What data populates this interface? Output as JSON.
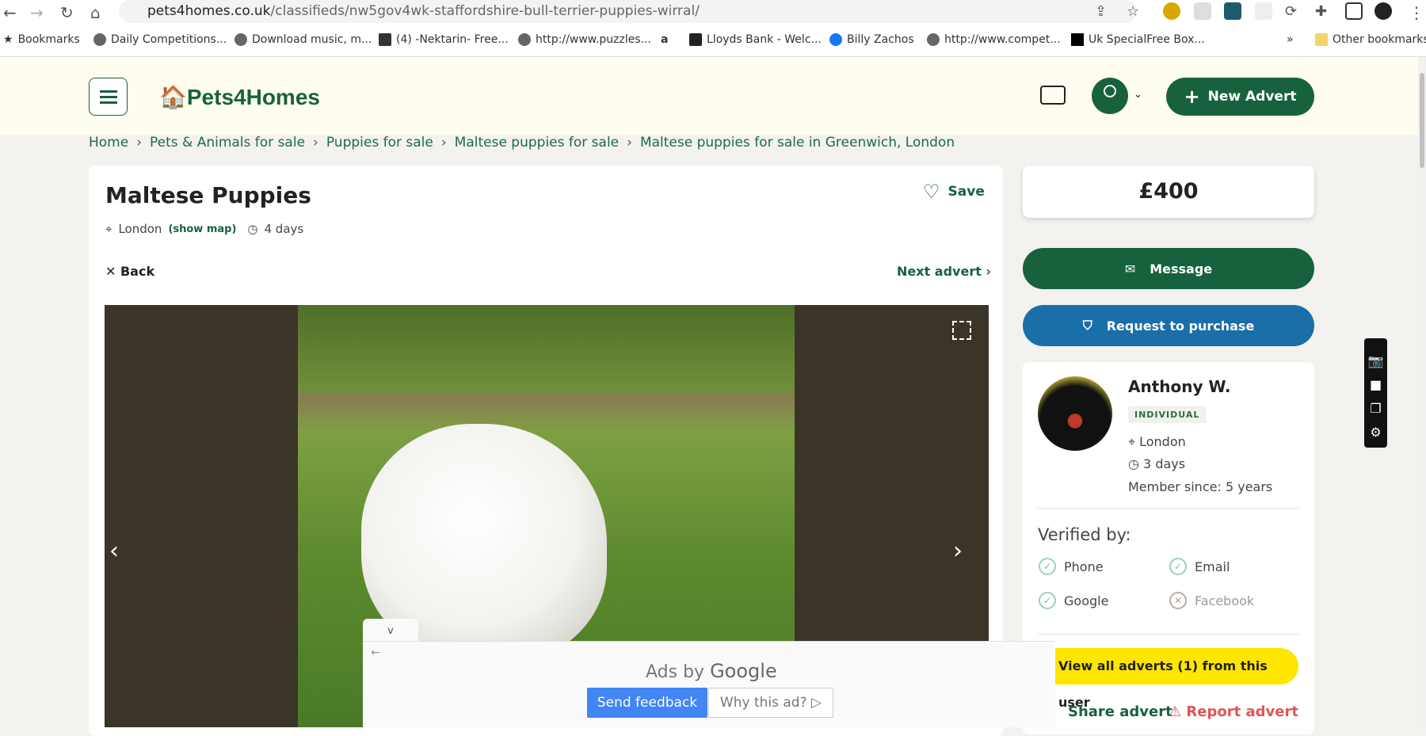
{
  "browser": {
    "url_host": "pets4homes.co.uk",
    "url_path": "/classifieds/nw5gov4wk-staffordshire-bull-terrier-puppies-wirral/",
    "bookmarks": [
      "Bookmarks",
      "Daily Competitions...",
      "Download music, m...",
      "(4) -Nektarin- Free...",
      "http://www.puzzles...",
      "",
      "Lloyds Bank - Welc...",
      "Billy Zachos",
      "http://www.compet...",
      "Uk SpecialFree Box..."
    ],
    "other_bookmarks": "Other bookmarks",
    "more": "»"
  },
  "header": {
    "logo": "Pets4Homes",
    "new_advert": "New Advert"
  },
  "breadcrumb": [
    "Home",
    "Pets & Animals for sale",
    "Puppies for sale",
    "Maltese puppies for sale",
    "Maltese puppies for sale in Greenwich, London"
  ],
  "listing": {
    "title": "Maltese Puppies",
    "save": "Save",
    "location": "London",
    "show_map": "(show map)",
    "age": "4 days",
    "back": "Back",
    "next": "Next advert",
    "price": "£400"
  },
  "actions": {
    "message": "Message",
    "request": "Request to purchase"
  },
  "seller": {
    "name": "Anthony W.",
    "type": "INDIVIDUAL",
    "location": "London",
    "age": "3 days",
    "member_since_label": "Member since:",
    "member_since": "5 years",
    "verified_label": "Verified by:",
    "verified": [
      {
        "label": "Phone",
        "ok": true
      },
      {
        "label": "Email",
        "ok": true
      },
      {
        "label": "Google",
        "ok": true
      },
      {
        "label": "Facebook",
        "ok": false
      }
    ],
    "view_all": "View all adverts (1) from this user",
    "share": "Share advert",
    "report": "Report advert"
  },
  "ad": {
    "tab": "v",
    "ads_by": "Ads by",
    "google": "Google",
    "send_feedback": "Send feedback",
    "why": "Why this ad? ▷"
  },
  "colors": {
    "brand": "#17623d",
    "blue": "#1a6fa8",
    "yellow": "#ffe600",
    "report": "#e05555"
  }
}
